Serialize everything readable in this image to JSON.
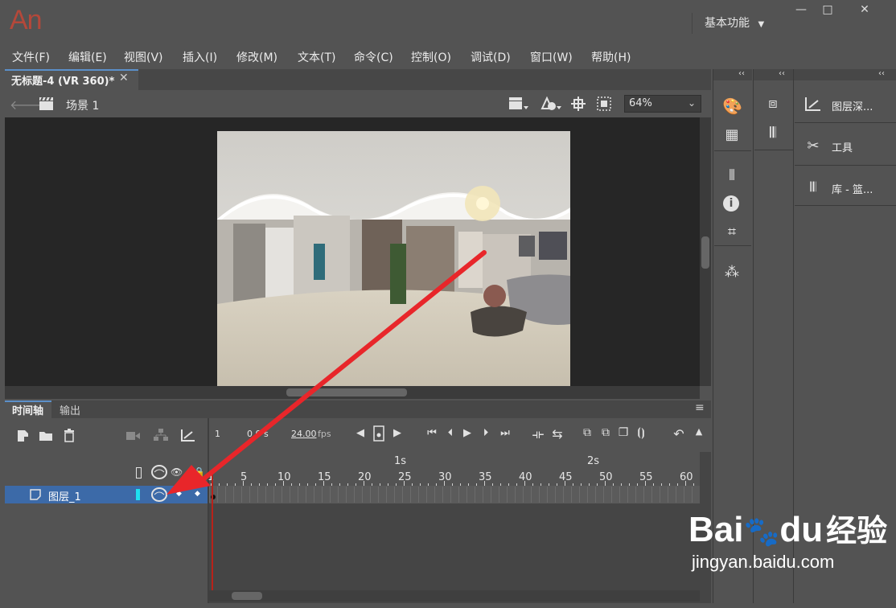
{
  "app": {
    "logo": "An",
    "workspace": "基本功能",
    "window_buttons": [
      "—",
      "□",
      "✕"
    ]
  },
  "menu": [
    "文件(F)",
    "编辑(E)",
    "视图(V)",
    "插入(I)",
    "修改(M)",
    "文本(T)",
    "命令(C)",
    "控制(O)",
    "调试(D)",
    "窗口(W)",
    "帮助(H)"
  ],
  "document": {
    "tab_title": "无标题-4 (VR 360)*",
    "close_glyph": "✕",
    "scene": "场景 1",
    "zoom": "64%"
  },
  "timeline": {
    "tabs": [
      "时间轴",
      "输出"
    ],
    "current_frame": "1",
    "time": "0.0 s",
    "fps_value": "24.00",
    "fps_unit": "fps",
    "ruler_seconds": [
      "1s",
      "2s"
    ],
    "ruler_frames": [
      "1",
      "5",
      "10",
      "15",
      "20",
      "25",
      "30",
      "35",
      "40",
      "45",
      "50",
      "55",
      "60"
    ],
    "layers": [
      {
        "name": "图层_1",
        "selected": true
      }
    ]
  },
  "panels": {
    "right": [
      {
        "label": "图层深...",
        "icon": "layer-depth-icon"
      },
      {
        "label": "工具",
        "icon": "tools-icon"
      },
      {
        "label": "库 - 篮...",
        "icon": "library-icon"
      }
    ],
    "collapse_glyph": "‹‹"
  },
  "watermark": {
    "brand": "Bai",
    "brand2": "du",
    "suffix": "经验",
    "url": "jingyan.baidu.com"
  },
  "colors": {
    "accent": "#5b8fc9",
    "layer_selected": "#3c6aa8",
    "playhead": "#b8221a",
    "annotation_arrow": "#e8262a",
    "logo": "#b4483a"
  }
}
